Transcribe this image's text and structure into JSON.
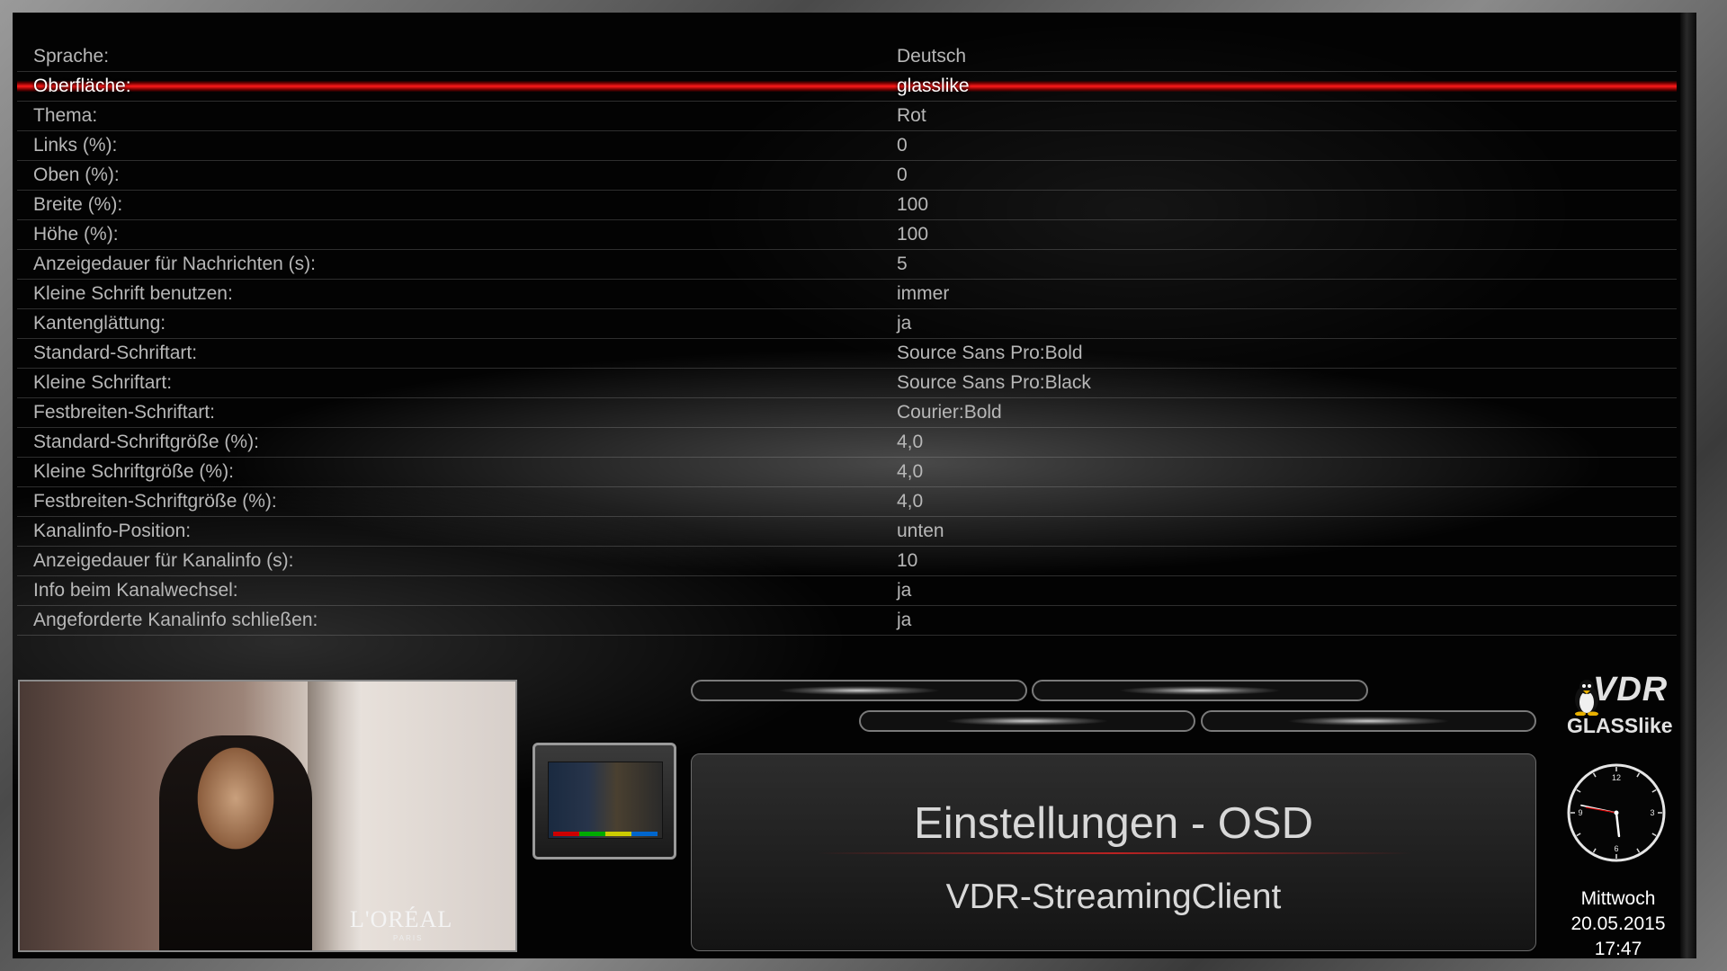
{
  "settings": [
    {
      "label": "Sprache:",
      "value": "Deutsch",
      "selected": false
    },
    {
      "label": "Oberfläche:",
      "value": "glasslike",
      "selected": true
    },
    {
      "label": "Thema:",
      "value": "Rot",
      "selected": false
    },
    {
      "label": "Links (%):",
      "value": "0",
      "selected": false
    },
    {
      "label": "Oben (%):",
      "value": "0",
      "selected": false
    },
    {
      "label": "Breite (%):",
      "value": "100",
      "selected": false
    },
    {
      "label": "Höhe (%):",
      "value": "100",
      "selected": false
    },
    {
      "label": "Anzeigedauer für Nachrichten (s):",
      "value": "5",
      "selected": false
    },
    {
      "label": "Kleine Schrift benutzen:",
      "value": "immer",
      "selected": false
    },
    {
      "label": "Kantenglättung:",
      "value": "ja",
      "selected": false
    },
    {
      "label": "Standard-Schriftart:",
      "value": "Source Sans Pro:Bold",
      "selected": false
    },
    {
      "label": "Kleine Schriftart:",
      "value": "Source Sans Pro:Black",
      "selected": false
    },
    {
      "label": "Festbreiten-Schriftart:",
      "value": "Courier:Bold",
      "selected": false
    },
    {
      "label": "Standard-Schriftgröße (%):",
      "value": "4,0",
      "selected": false
    },
    {
      "label": "Kleine Schriftgröße (%):",
      "value": "4,0",
      "selected": false
    },
    {
      "label": "Festbreiten-Schriftgröße (%):",
      "value": "4,0",
      "selected": false
    },
    {
      "label": "Kanalinfo-Position:",
      "value": "unten",
      "selected": false
    },
    {
      "label": "Anzeigedauer für Kanalinfo (s):",
      "value": "10",
      "selected": false
    },
    {
      "label": "Info beim Kanalwechsel:",
      "value": "ja",
      "selected": false
    },
    {
      "label": "Angeforderte Kanalinfo schließen:",
      "value": "ja",
      "selected": false
    }
  ],
  "preview": {
    "brand": "L'ORÉAL",
    "brand_sub": "PARIS"
  },
  "title": {
    "main": "Einstellungen - OSD",
    "sub": "VDR-StreamingClient"
  },
  "logo": {
    "top": "VDR",
    "bottom": "GLASSlike"
  },
  "datetime": {
    "weekday": "Mittwoch",
    "date": "20.05.2015",
    "time": "17:47"
  },
  "clock": {
    "hour": 17,
    "minute": 47
  },
  "colors": {
    "accent": "#e00000",
    "text": "#b7b7b7",
    "selected_text": "#ffffff"
  },
  "icons": [
    "tux-icon",
    "clock-icon",
    "tv-icon"
  ]
}
